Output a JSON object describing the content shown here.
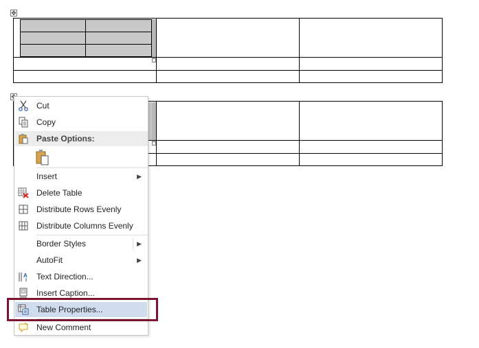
{
  "menu": {
    "cut": "Cut",
    "copy": "Copy",
    "paste_options": "Paste Options:",
    "insert": "Insert",
    "delete_table": "Delete Table",
    "distribute_rows": "Distribute Rows Evenly",
    "distribute_columns": "Distribute Columns Evenly",
    "border_styles": "Border Styles",
    "autofit": "AutoFit",
    "text_direction": "Text Direction...",
    "insert_caption": "Insert Caption...",
    "table_properties": "Table Properties...",
    "new_comment": "New Comment"
  },
  "icons": {
    "move_handle": "move-handle-icon",
    "cut": "scissors-icon",
    "copy": "copy-icon",
    "paste": "clipboard-icon",
    "delete_table": "delete-table-icon",
    "distribute_rows": "distribute-rows-icon",
    "distribute_columns": "distribute-columns-icon",
    "text_direction": "text-direction-icon",
    "insert_caption": "caption-icon",
    "table_properties": "table-properties-icon",
    "new_comment": "comment-icon"
  },
  "colors": {
    "highlight_border": "#7a1430",
    "hover_background": "#cfdcee",
    "selected_cells": "#c8c8c8"
  }
}
